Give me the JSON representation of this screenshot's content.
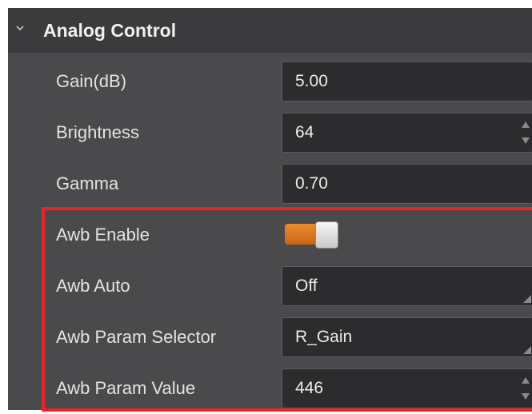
{
  "section": {
    "title": "Analog Control",
    "expanded": true
  },
  "rows": [
    {
      "label": "Gain(dB)",
      "value": "5.00",
      "control": "text"
    },
    {
      "label": "Brightness",
      "value": "64",
      "control": "spinbox"
    },
    {
      "label": "Gamma",
      "value": "0.70",
      "control": "text"
    },
    {
      "label": "Awb Enable",
      "value": true,
      "control": "toggle"
    },
    {
      "label": "Awb Auto",
      "value": "Off",
      "control": "dropdown"
    },
    {
      "label": "Awb Param Selector",
      "value": "R_Gain",
      "control": "dropdown"
    },
    {
      "label": "Awb Param Value",
      "value": "446",
      "control": "spinbox"
    }
  ],
  "highlight": {
    "color": "#e8232e",
    "covers_rows": [
      "Awb Enable",
      "Awb Auto",
      "Awb Param Selector",
      "Awb Param Value"
    ]
  },
  "colors": {
    "panel_bg": "#4a4a4c",
    "header_bg": "#3b3b3d",
    "field_bg": "#2c2c2e",
    "toggle_on": "#e07a22"
  },
  "icons": {
    "collapse": "chevron-down-icon",
    "spin": "spin-arrows-icon",
    "dropdown": "dropdown-corner-icon"
  }
}
